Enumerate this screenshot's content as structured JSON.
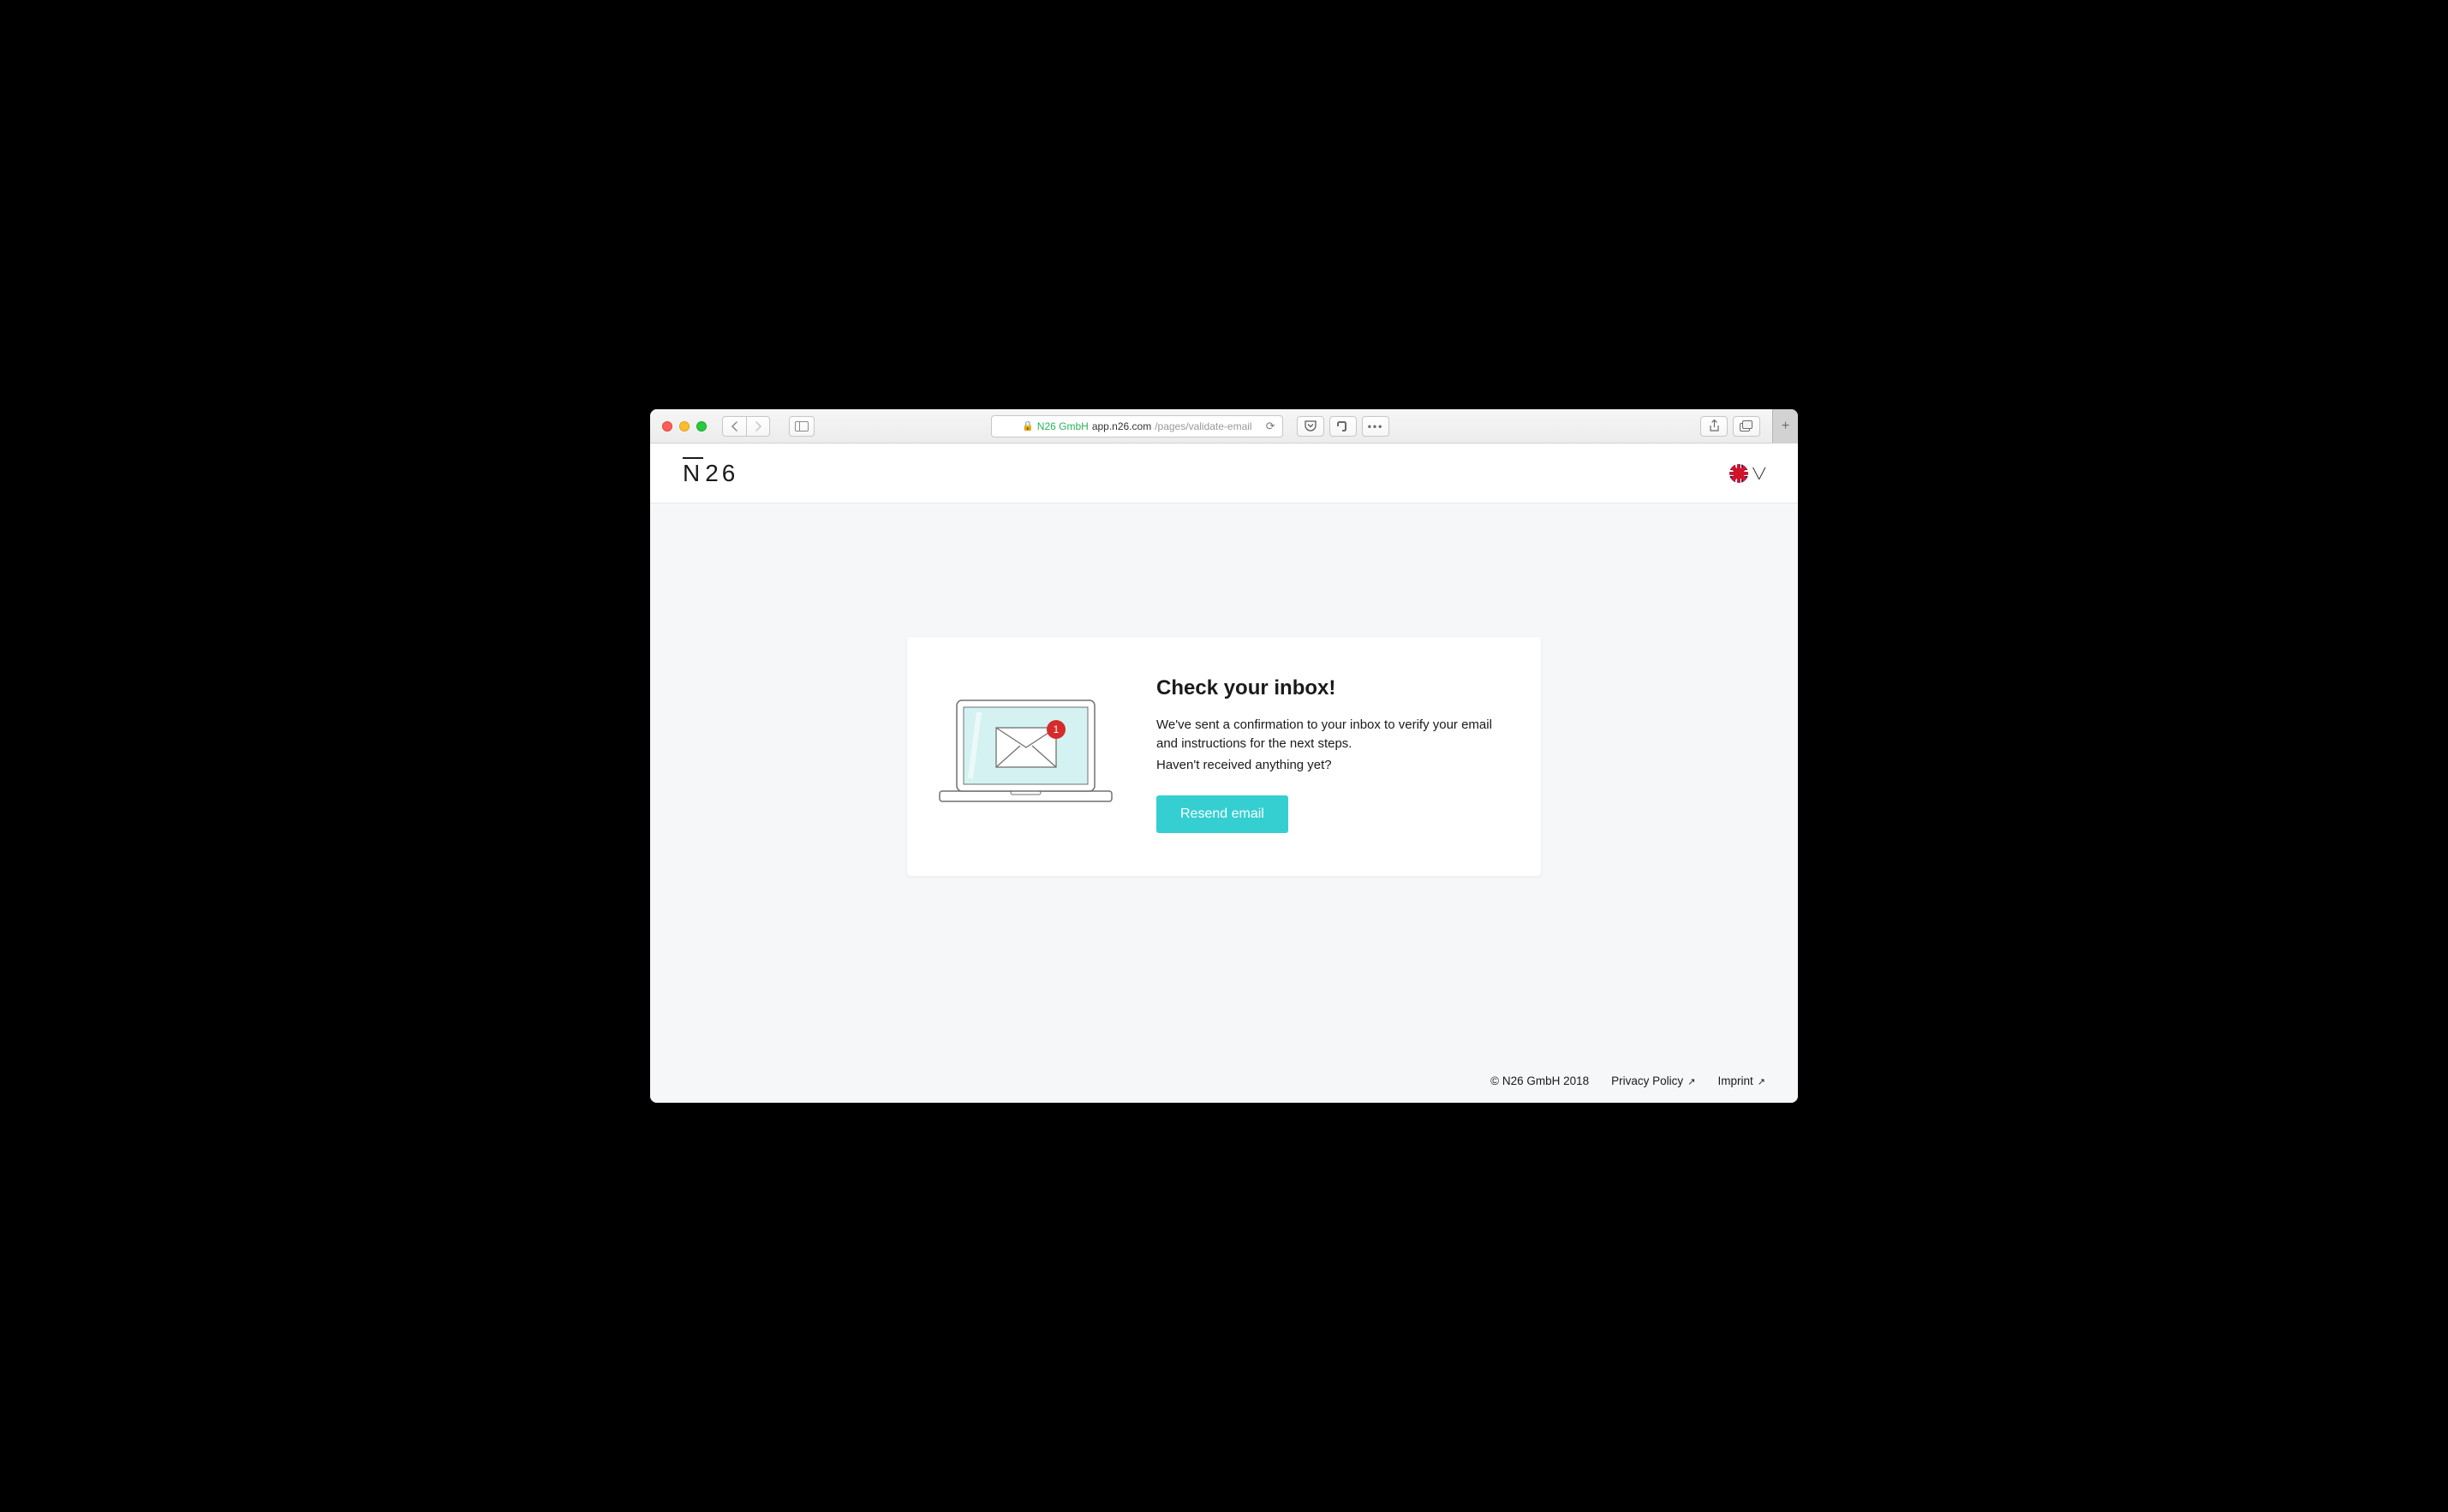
{
  "browser": {
    "url_org": "N26 GmbH",
    "url_domain": "app.n26.com",
    "url_path": "/pages/validate-email"
  },
  "header": {
    "logo_text_n": "N",
    "logo_text_26": "26"
  },
  "card": {
    "title": "Check your inbox!",
    "body_line1": "We've sent a confirmation to your inbox to verify your email and instructions for the next steps.",
    "body_line2": "Haven't received anything yet?",
    "button_label": "Resend email",
    "badge_count": "1"
  },
  "footer": {
    "copyright": "© N26 GmbH 2018",
    "privacy": "Privacy Policy",
    "imprint": "Imprint"
  }
}
